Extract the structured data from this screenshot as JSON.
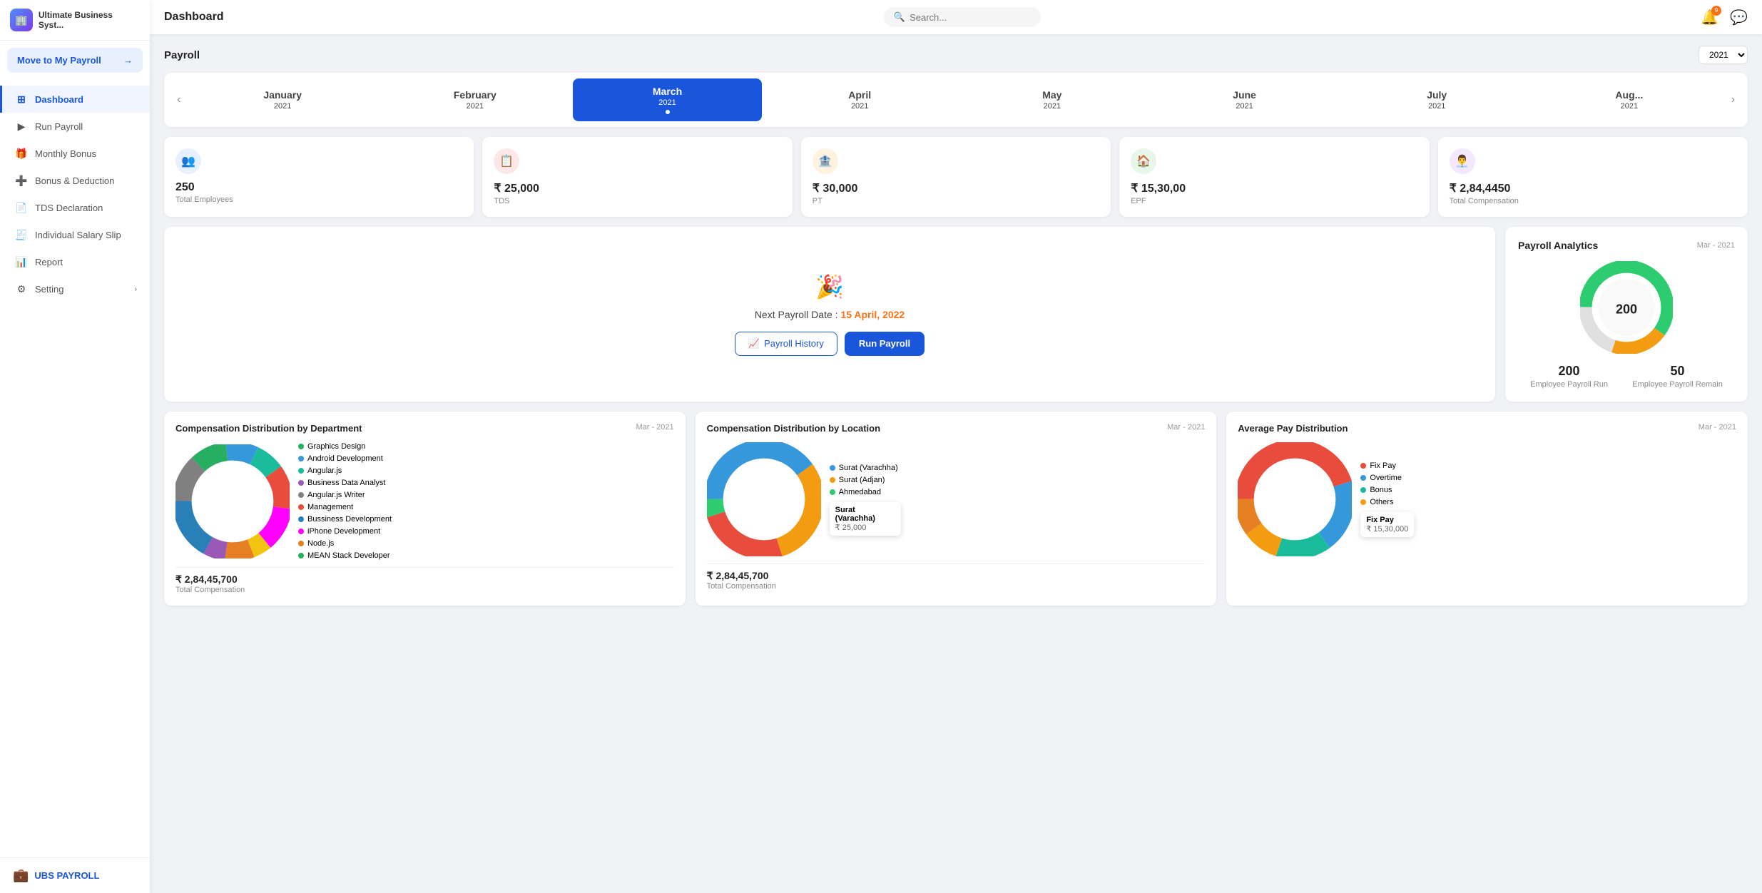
{
  "app": {
    "name": "Ultimate Business Syst...",
    "logo_emoji": "🏢"
  },
  "sidebar": {
    "move_to_payroll": "Move to My Payroll",
    "nav_items": [
      {
        "id": "dashboard",
        "label": "Dashboard",
        "icon": "⊞",
        "active": true
      },
      {
        "id": "run-payroll",
        "label": "Run Payroll",
        "icon": "▶",
        "active": false
      },
      {
        "id": "monthly-bonus",
        "label": "Monthly Bonus",
        "icon": "🎁",
        "active": false
      },
      {
        "id": "bonus-deduction",
        "label": "Bonus & Deduction",
        "icon": "➕",
        "active": false
      },
      {
        "id": "tds-declaration",
        "label": "TDS Declaration",
        "icon": "📄",
        "active": false
      },
      {
        "id": "individual-salary",
        "label": "Individual Salary Slip",
        "icon": "🧾",
        "active": false
      },
      {
        "id": "report",
        "label": "Report",
        "icon": "📊",
        "active": false
      },
      {
        "id": "setting",
        "label": "Setting",
        "icon": "⚙",
        "active": false,
        "arrow": true
      }
    ],
    "footer_label": "UBS PAYROLL"
  },
  "topbar": {
    "title": "Dashboard",
    "search_placeholder": "Search...",
    "notification_count": "9"
  },
  "payroll": {
    "title": "Payroll",
    "year": "2021",
    "months": [
      {
        "name": "January",
        "year": "2021",
        "active": false
      },
      {
        "name": "February",
        "year": "2021",
        "active": false
      },
      {
        "name": "March",
        "year": "2021",
        "active": true
      },
      {
        "name": "April",
        "year": "2021",
        "active": false
      },
      {
        "name": "May",
        "year": "2021",
        "active": false
      },
      {
        "name": "June",
        "year": "2021",
        "active": false
      },
      {
        "name": "July",
        "year": "2021",
        "active": false
      },
      {
        "name": "August",
        "year": "2021",
        "active": false
      }
    ]
  },
  "stats": [
    {
      "id": "employees",
      "icon": "👥",
      "icon_bg": "#e8f0fe",
      "value": "250",
      "label": "Total Employees"
    },
    {
      "id": "tds",
      "icon": "📋",
      "icon_bg": "#fce8e8",
      "value": "₹ 25,000",
      "label": "TDS"
    },
    {
      "id": "pt",
      "icon": "🏦",
      "icon_bg": "#fff3e0",
      "value": "₹ 30,000",
      "label": "PT"
    },
    {
      "id": "epf",
      "icon": "🏠",
      "icon_bg": "#e8f5e9",
      "value": "₹ 15,30,00",
      "label": "EPF"
    },
    {
      "id": "total-comp",
      "icon": "👨‍💼",
      "icon_bg": "#f3e8ff",
      "value": "₹ 2,84,4450",
      "label": "Total Compensation"
    }
  ],
  "next_payroll": {
    "emoji": "🎉",
    "text_prefix": "Next Payroll Date : ",
    "date": "15 April, 2022",
    "btn_history": "Payroll History",
    "btn_run": "Run Payroll"
  },
  "analytics": {
    "title": "Payroll Analytics",
    "period": "Mar - 2021",
    "center_value": "200",
    "segments": [
      {
        "color": "#2ecc71",
        "pct": 60
      },
      {
        "color": "#f39c12",
        "pct": 20
      },
      {
        "color": "#e5e5e5",
        "pct": 20
      }
    ],
    "stat1_value": "200",
    "stat1_label": "Employee Payroll Run",
    "stat2_value": "50",
    "stat2_label": "Employee Payroll Remain"
  },
  "dept_chart": {
    "title": "Compensation Distribution by Department",
    "period": "Mar - 2021",
    "segments": [
      {
        "color": "#808080",
        "pct": 13
      },
      {
        "color": "#27ae60",
        "pct": 10
      },
      {
        "color": "#3498db",
        "pct": 9
      },
      {
        "color": "#1abc9c",
        "pct": 8
      },
      {
        "color": "#e74c3c",
        "pct": 12
      },
      {
        "color": "#ff00ff",
        "pct": 12
      },
      {
        "color": "#f1c40f",
        "pct": 5
      },
      {
        "color": "#e67e22",
        "pct": 8
      },
      {
        "color": "#9b59b6",
        "pct": 6
      },
      {
        "color": "#2980b9",
        "pct": 17
      }
    ],
    "legend": [
      {
        "color": "#27ae60",
        "label": "Graphics Design"
      },
      {
        "color": "#3498db",
        "label": "Android Development"
      },
      {
        "color": "#1abc9c",
        "label": "Angular.js"
      },
      {
        "color": "#9b59b6",
        "label": "Business Data Analyst"
      },
      {
        "color": "#808080",
        "label": "Angular.js"
      },
      {
        "color": "#f1c40f",
        "label": "Writer"
      },
      {
        "color": "#e74c3c",
        "label": "Management"
      },
      {
        "color": "#2980b9",
        "label": "Bussiness Development"
      },
      {
        "color": "#ff00ff",
        "label": "iPhone Development"
      },
      {
        "color": "#e67e22",
        "label": "Node.js"
      },
      {
        "color": "#27ae60",
        "label": "MEAN Stack Developer"
      }
    ],
    "footer_value": "₹ 2,84,45,700",
    "footer_label": "Total Compensation"
  },
  "location_chart": {
    "title": "Compensation Distribution by Location",
    "period": "Mar - 2021",
    "segments": [
      {
        "color": "#3498db",
        "pct": 40
      },
      {
        "color": "#f39c12",
        "pct": 30
      },
      {
        "color": "#e74c3c",
        "pct": 25
      },
      {
        "color": "#2ecc71",
        "pct": 5
      }
    ],
    "legend": [
      {
        "color": "#3498db",
        "label": "Surat (Varachha)"
      },
      {
        "color": "#f39c12",
        "label": "Surat (Adjan)"
      },
      {
        "color": "#2ecc71",
        "label": "Ahmedabad"
      }
    ],
    "tooltip_label": "Surat (Varachha)",
    "tooltip_value": "₹ 25,000",
    "footer_value": "₹ 2,84,45,700",
    "footer_label": "Total Compensation"
  },
  "avg_pay_chart": {
    "title": "Average Pay Distribution",
    "period": "Mar - 2021",
    "segments": [
      {
        "color": "#e74c3c",
        "pct": 45
      },
      {
        "color": "#3498db",
        "pct": 20
      },
      {
        "color": "#1abc9c",
        "pct": 15
      },
      {
        "color": "#f39c12",
        "pct": 10
      },
      {
        "color": "#e67e22",
        "pct": 10
      }
    ],
    "legend": [
      {
        "color": "#e74c3c",
        "label": "Fix Pay"
      },
      {
        "color": "#3498db",
        "label": "Overtime"
      },
      {
        "color": "#1abc9c",
        "label": "Bonus"
      },
      {
        "color": "#f39c12",
        "label": "Others"
      }
    ],
    "tooltip_label": "Fix Pay",
    "tooltip_value": "₹ 15,30,000"
  }
}
